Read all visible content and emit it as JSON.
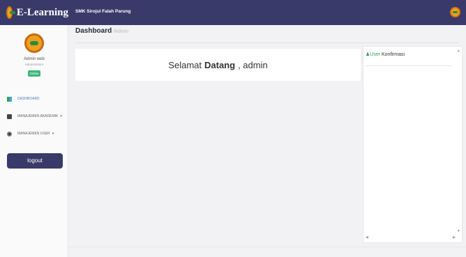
{
  "header": {
    "brand": "E-Learning",
    "school": "SMK Sirojul Falah Parung"
  },
  "user": {
    "name": "Admin web",
    "role": "Administrator",
    "status": "Online"
  },
  "menu": [
    {
      "label": "DASHBOARD",
      "icon": "dashboard-icon"
    },
    {
      "label": "MANAJEMEN AKADEMIK"
    },
    {
      "label": "MANAJEMEN USER"
    }
  ],
  "logout_label": "logout",
  "breadcrumb": {
    "title": "Dashboard",
    "sub": "/Admin"
  },
  "welcome": {
    "pre": "Selamat",
    "bold": "Datang",
    "post": ", admin"
  },
  "panel": {
    "user": "User",
    "title": " Konfirmasi"
  },
  "colors": {
    "header": "#3a3a6a",
    "accent_green": "#2ea44f",
    "accent_blue": "#4a7fc0"
  }
}
